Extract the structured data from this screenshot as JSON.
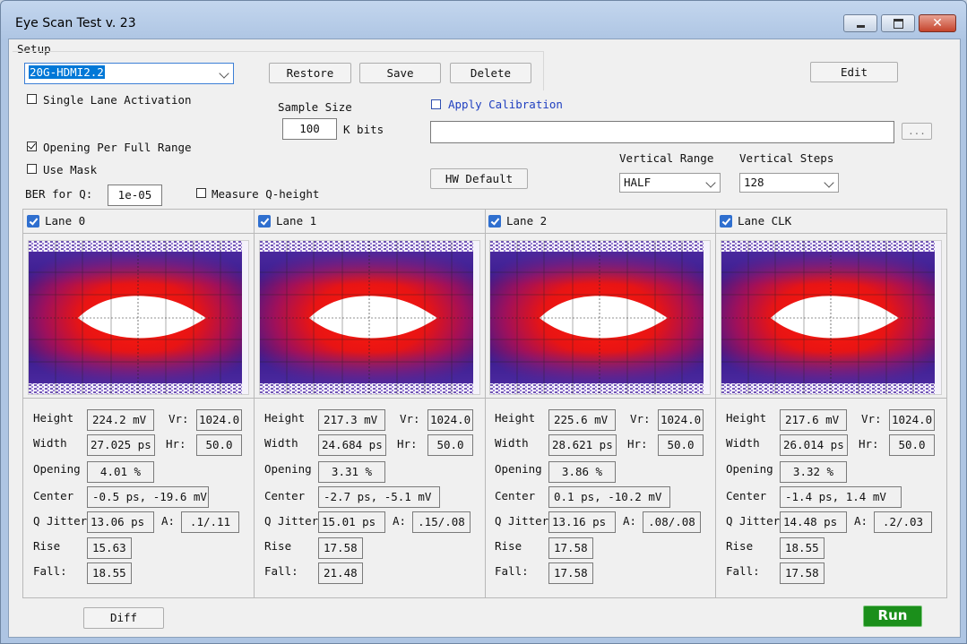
{
  "window": {
    "title": "Eye Scan Test v. 23"
  },
  "setup": {
    "group_label": "Setup",
    "profile": "20G-HDMI2.2",
    "restore": "Restore",
    "save": "Save",
    "delete": "Delete",
    "edit": "Edit",
    "single_lane": "Single Lane Activation",
    "opening_full_range": "Opening Per Full Range",
    "use_mask": "Use Mask",
    "ber_label": "BER for Q:",
    "ber_value": "1e-05",
    "measure_q": "Measure Q-height",
    "sample_size_label": "Sample Size",
    "sample_size": "100",
    "sample_unit": "K bits",
    "apply_calibration": "Apply Calibration",
    "calibration_path": "",
    "browse": "...",
    "hw_default": "HW Default",
    "vertical_range_label": "Vertical Range",
    "vertical_range": "HALF",
    "vertical_steps_label": "Vertical Steps",
    "vertical_steps": "128"
  },
  "labels": {
    "height": "Height",
    "vr": "Vr:",
    "width": "Width",
    "hr": "Hr:",
    "opening": "Opening",
    "center": "Center",
    "qjitter": "Q Jitter",
    "a": "A:",
    "rise": "Rise",
    "fall": "Fall:"
  },
  "lanes": [
    {
      "name": "Lane 0",
      "height": "224.2 mV",
      "vr": "1024.0",
      "width": "27.025 ps",
      "hr": "50.0",
      "opening": "4.01 %",
      "center": "-0.5 ps, -19.6 mV",
      "qjitter": "13.06 ps",
      "a": ".1/.11",
      "rise": "15.63",
      "fall": "18.55"
    },
    {
      "name": "Lane 1",
      "height": "217.3 mV",
      "vr": "1024.0",
      "width": "24.684 ps",
      "hr": "50.0",
      "opening": "3.31 %",
      "center": "-2.7 ps, -5.1 mV",
      "qjitter": "15.01 ps",
      "a": ".15/.08",
      "rise": "17.58",
      "fall": "21.48"
    },
    {
      "name": "Lane 2",
      "height": "225.6 mV",
      "vr": "1024.0",
      "width": "28.621 ps",
      "hr": "50.0",
      "opening": "3.86 %",
      "center": "0.1 ps, -10.2 mV",
      "qjitter": "13.16 ps",
      "a": ".08/.08",
      "rise": "17.58",
      "fall": "17.58"
    },
    {
      "name": "Lane CLK",
      "height": "217.6 mV",
      "vr": "1024.0",
      "width": "26.014 ps",
      "hr": "50.0",
      "opening": "3.32 %",
      "center": "-1.4 ps, 1.4 mV",
      "qjitter": "14.48 ps",
      "a": ".2/.03",
      "rise": "18.55",
      "fall": "17.58"
    }
  ],
  "footer": {
    "diff": "Diff",
    "run": "Run"
  },
  "colors": {
    "run_bg": "#1b8f1b",
    "eye_red": "#e81414",
    "eye_purple": "#3a1a8c",
    "check_blue": "#2f6fcf"
  }
}
